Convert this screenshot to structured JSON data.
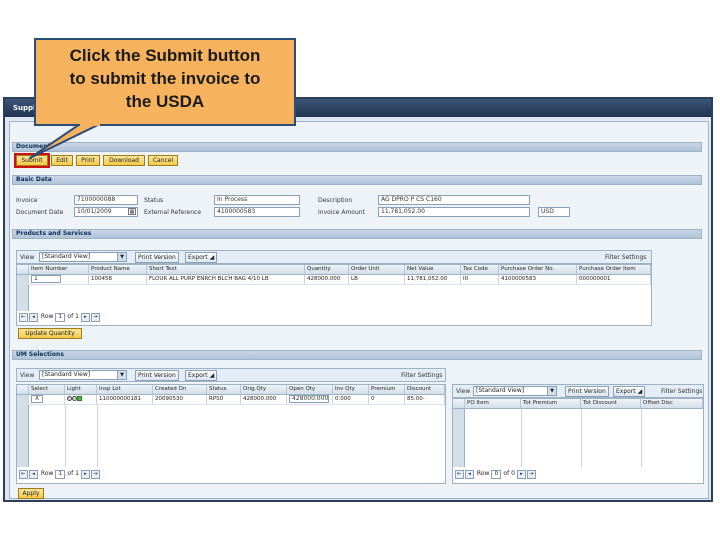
{
  "window": {
    "title": "Supplier Invoice"
  },
  "callout": {
    "line1": "Click the Submit button",
    "line2": "to submit the invoice to",
    "line3": "the USDA"
  },
  "document": {
    "section": "Document",
    "buttons": {
      "submit": "Submit",
      "edit": "Edit",
      "print": "Print",
      "download": "Download",
      "cancel": "Cancel"
    }
  },
  "basic": {
    "section": "Basic Data",
    "invoice_label": "Invoice",
    "invoice_value": "7100000088",
    "status_label": "Status",
    "status_value": "In Process",
    "description_label": "Description",
    "description_value": "AG DPRO P CS C160",
    "docdate_label": "Document Date",
    "docdate_value": "10/01/2009",
    "extref_label": "External Reference",
    "extref_value": "4100000583",
    "amount_label": "Invoice Amount",
    "amount_value": "11,781,052.00",
    "currency": "USD"
  },
  "products": {
    "section": "Products and Services",
    "view_label": "View",
    "view_value": "[Standard View]",
    "print_label": "Print Version",
    "export_label": "Export",
    "settings_label": "Filter Settings",
    "columns": [
      "Item Number",
      "Product Name",
      "Short Text",
      "Quantity",
      "Order Unit",
      "Net Value",
      "Tax Code",
      "Purchase Order No.",
      "Purchase Order Item"
    ],
    "row": [
      "1",
      "100458",
      "FLOUR ALL PURP ENRCH BLCH BAG 4/10 LB",
      "428000.000",
      "LB",
      "11,781,052.00",
      "I0",
      "4100000583",
      "000000001"
    ],
    "pager": {
      "row_label": "Row",
      "row_value": "1",
      "of_label": "of 1"
    },
    "update_button": "Update Quantity"
  },
  "um": {
    "section": "UM Selections",
    "view_label": "View",
    "view_value": "[Standard View]",
    "print_label": "Print Version",
    "export_label": "Export",
    "settings_label": "Filter Settings",
    "columns": [
      "Select",
      "Light",
      "Insp Lot",
      "Created On",
      "Status",
      "Orig.Qty",
      "Open Qty",
      "Inv Qty",
      "Premium",
      "Discount"
    ],
    "row": [
      "X",
      "",
      "110000000181",
      "20090530",
      "RPS0",
      "428000.000",
      "428000.000",
      "0.000",
      "0",
      "85.00-"
    ],
    "pager": {
      "row_label": "Row",
      "row_value": "1",
      "of_label": "of 1"
    },
    "apply_button": "Apply"
  },
  "right": {
    "view_label": "View",
    "view_value": "[Standard View]",
    "print_label": "Print Version",
    "export_label": "Export",
    "settings_label": "Filter Settings",
    "columns": [
      "PO Item",
      "Tot Premium",
      "Tot Discount",
      "Offset Disc"
    ],
    "pager": {
      "row_label": "Row",
      "row_value": "0",
      "of_label": "of 0"
    }
  },
  "colors": {
    "callout": "#f6b25c",
    "submit_outline": "#d01010",
    "title_bar": "#2c3f5a"
  }
}
